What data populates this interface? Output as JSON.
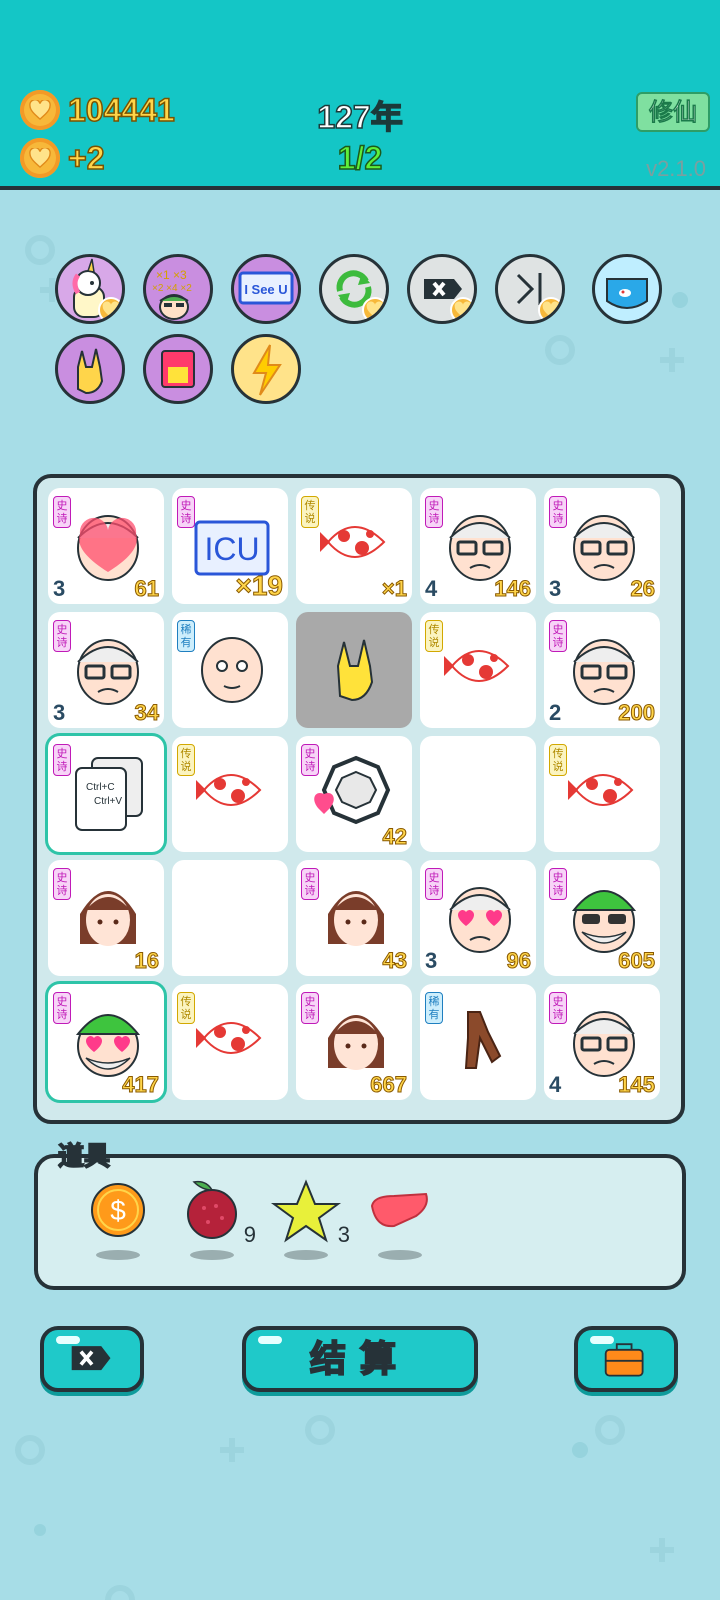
{
  "header": {
    "coins": "104441",
    "coin_gain": "+2",
    "year": "127年",
    "round": "1/2",
    "cultivate_label": "修仙",
    "version": "v2.1.0"
  },
  "skills": [
    {
      "name": "unicorn",
      "icon": "unicorn-icon"
    },
    {
      "name": "multiply",
      "icon": "multiply-face-icon"
    },
    {
      "name": "i-see-u",
      "icon": "i-see-u-icon",
      "text": "I See U"
    },
    {
      "name": "refresh",
      "icon": "refresh-icon"
    },
    {
      "name": "remove",
      "icon": "remove-tag-icon"
    },
    {
      "name": "skip",
      "icon": "skip-icon"
    },
    {
      "name": "fishbowl",
      "icon": "fishbowl-icon"
    },
    {
      "name": "rock-hand",
      "icon": "rock-hand-icon"
    },
    {
      "name": "box",
      "icon": "box-icon"
    },
    {
      "name": "lightning",
      "icon": "lightning-icon"
    }
  ],
  "board": {
    "rows": [
      [
        {
          "tag": "史诗",
          "rarity": "epic",
          "art": "old-man-heart",
          "count": "3",
          "value": "61"
        },
        {
          "tag": "史诗",
          "rarity": "epic",
          "art": "icu",
          "text": "ICU",
          "mult": "×19"
        },
        {
          "tag": "传说",
          "rarity": "legend",
          "art": "koi",
          "mult": "×1"
        },
        {
          "tag": "史诗",
          "rarity": "epic",
          "art": "old-man",
          "count": "4",
          "value": "146"
        },
        {
          "tag": "史诗",
          "rarity": "epic",
          "art": "old-man",
          "count": "3",
          "value": "26"
        }
      ],
      [
        {
          "tag": "史诗",
          "rarity": "epic",
          "art": "old-man",
          "count": "3",
          "value": "34"
        },
        {
          "tag": "稀有",
          "rarity": "rare",
          "art": "bald-man"
        },
        {
          "art": "rock-hand",
          "gray": true
        },
        {
          "tag": "传说",
          "rarity": "legend",
          "art": "koi"
        },
        {
          "tag": "史诗",
          "rarity": "epic",
          "art": "old-man",
          "count": "2",
          "value": "200"
        }
      ],
      [
        {
          "tag": "史诗",
          "rarity": "epic",
          "art": "copy-paste",
          "line1": "Ctrl+C",
          "line2": "Ctrl+V",
          "selected": true
        },
        {
          "tag": "传说",
          "rarity": "legend",
          "art": "koi"
        },
        {
          "tag": "史诗",
          "rarity": "epic",
          "art": "bagua-heart",
          "value": "42"
        },
        {
          "art": "empty"
        },
        {
          "tag": "传说",
          "rarity": "legend",
          "art": "koi"
        }
      ],
      [
        {
          "tag": "史诗",
          "rarity": "epic",
          "art": "girl",
          "value": "16"
        },
        {
          "art": "empty"
        },
        {
          "tag": "史诗",
          "rarity": "epic",
          "art": "girl",
          "value": "43"
        },
        {
          "tag": "史诗",
          "rarity": "epic",
          "art": "old-man-hearteyes",
          "count": "3",
          "value": "96"
        },
        {
          "tag": "史诗",
          "rarity": "epic",
          "art": "green-hat-sunglasses",
          "value": "605"
        }
      ],
      [
        {
          "tag": "史诗",
          "rarity": "epic",
          "art": "green-hat-hearteyes",
          "value": "417",
          "selected": true
        },
        {
          "tag": "传说",
          "rarity": "legend",
          "art": "koi"
        },
        {
          "tag": "史诗",
          "rarity": "epic",
          "art": "girl",
          "value": "667"
        },
        {
          "tag": "稀有",
          "rarity": "rare",
          "art": "brown-hand"
        },
        {
          "tag": "史诗",
          "rarity": "epic",
          "art": "old-man",
          "count": "4",
          "value": "145"
        }
      ]
    ]
  },
  "items": {
    "label": "道具",
    "list": [
      {
        "name": "coin",
        "icon": "dollar-coin-icon",
        "count": ""
      },
      {
        "name": "bayberry",
        "icon": "bayberry-icon",
        "count": "9"
      },
      {
        "name": "star",
        "icon": "star-icon",
        "count": "3"
      },
      {
        "name": "liver",
        "icon": "liver-icon",
        "count": ""
      }
    ]
  },
  "buttons": {
    "settle_label": "结算"
  },
  "colors": {
    "header": "#14c6c6",
    "background": "#a7dde7",
    "epic": "#c01ab8",
    "legend": "#d2a800",
    "rare": "#1f7fc0",
    "value_text": "#ffd54a"
  }
}
